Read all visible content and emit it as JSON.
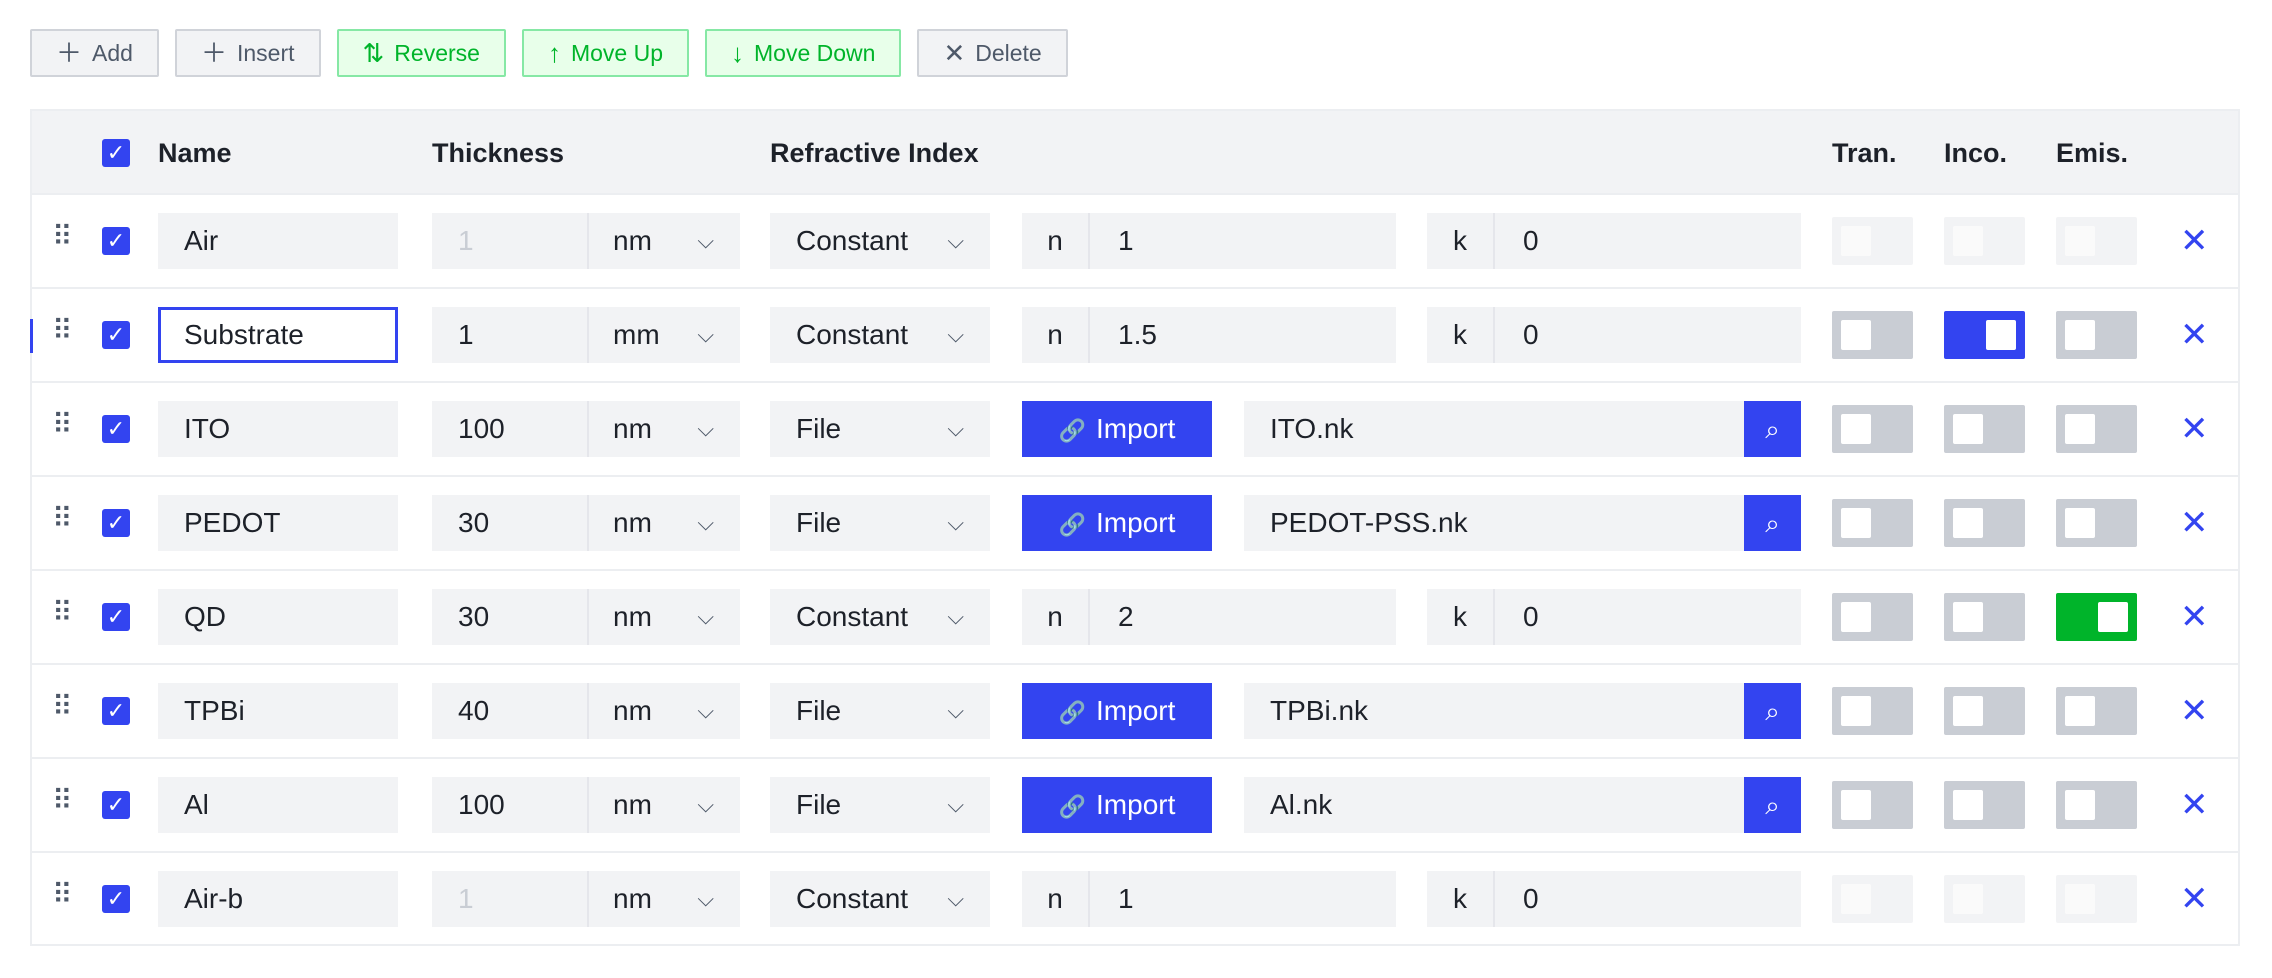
{
  "toolbar": {
    "add": {
      "icon": "＋",
      "label": "Add"
    },
    "insert": {
      "icon": "＋",
      "label": "Insert"
    },
    "reverse": {
      "icon": "⇅",
      "label": "Reverse"
    },
    "move_up": {
      "icon": "↑",
      "label": "Move Up"
    },
    "move_down": {
      "icon": "↓",
      "label": "Move Down"
    },
    "delete": {
      "icon": "✕",
      "label": "Delete"
    }
  },
  "headers": {
    "name": "Name",
    "thickness": "Thickness",
    "refractive_index": "Refractive Index",
    "tran": "Tran.",
    "inco": "Inco.",
    "emis": "Emis."
  },
  "glyphs": {
    "check": "✓",
    "drag": "⠿",
    "chevron": "⌵",
    "close": "✕",
    "clip": "🔗",
    "search": "⌕"
  },
  "labels": {
    "n": "n",
    "k": "k",
    "import": "Import"
  },
  "colors": {
    "accent": "#3344f0",
    "green": "#00b42a"
  },
  "layers": [
    {
      "name": "Air",
      "thickness": "1",
      "unit": "nm",
      "mode": "Constant",
      "n": "1",
      "k": "0",
      "tran": false,
      "inco": false,
      "emis": false,
      "disabled": true
    },
    {
      "name": "Substrate",
      "thickness": "1",
      "unit": "mm",
      "mode": "Constant",
      "n": "1.5",
      "k": "0",
      "tran": false,
      "inco": true,
      "emis": false,
      "active": true
    },
    {
      "name": "ITO",
      "thickness": "100",
      "unit": "nm",
      "mode": "File",
      "file": "ITO.nk",
      "tran": false,
      "inco": false,
      "emis": false
    },
    {
      "name": "PEDOT",
      "thickness": "30",
      "unit": "nm",
      "mode": "File",
      "file": "PEDOT-PSS.nk",
      "tran": false,
      "inco": false,
      "emis": false
    },
    {
      "name": "QD",
      "thickness": "30",
      "unit": "nm",
      "mode": "Constant",
      "n": "2",
      "k": "0",
      "tran": false,
      "inco": false,
      "emis": true
    },
    {
      "name": "TPBi",
      "thickness": "40",
      "unit": "nm",
      "mode": "File",
      "file": "TPBi.nk",
      "tran": false,
      "inco": false,
      "emis": false
    },
    {
      "name": "Al",
      "thickness": "100",
      "unit": "nm",
      "mode": "File",
      "file": "Al.nk",
      "tran": false,
      "inco": false,
      "emis": false
    },
    {
      "name": "Air-b",
      "thickness": "1",
      "unit": "nm",
      "mode": "Constant",
      "n": "1",
      "k": "0",
      "tran": false,
      "inco": false,
      "emis": false,
      "disabled": true
    }
  ]
}
